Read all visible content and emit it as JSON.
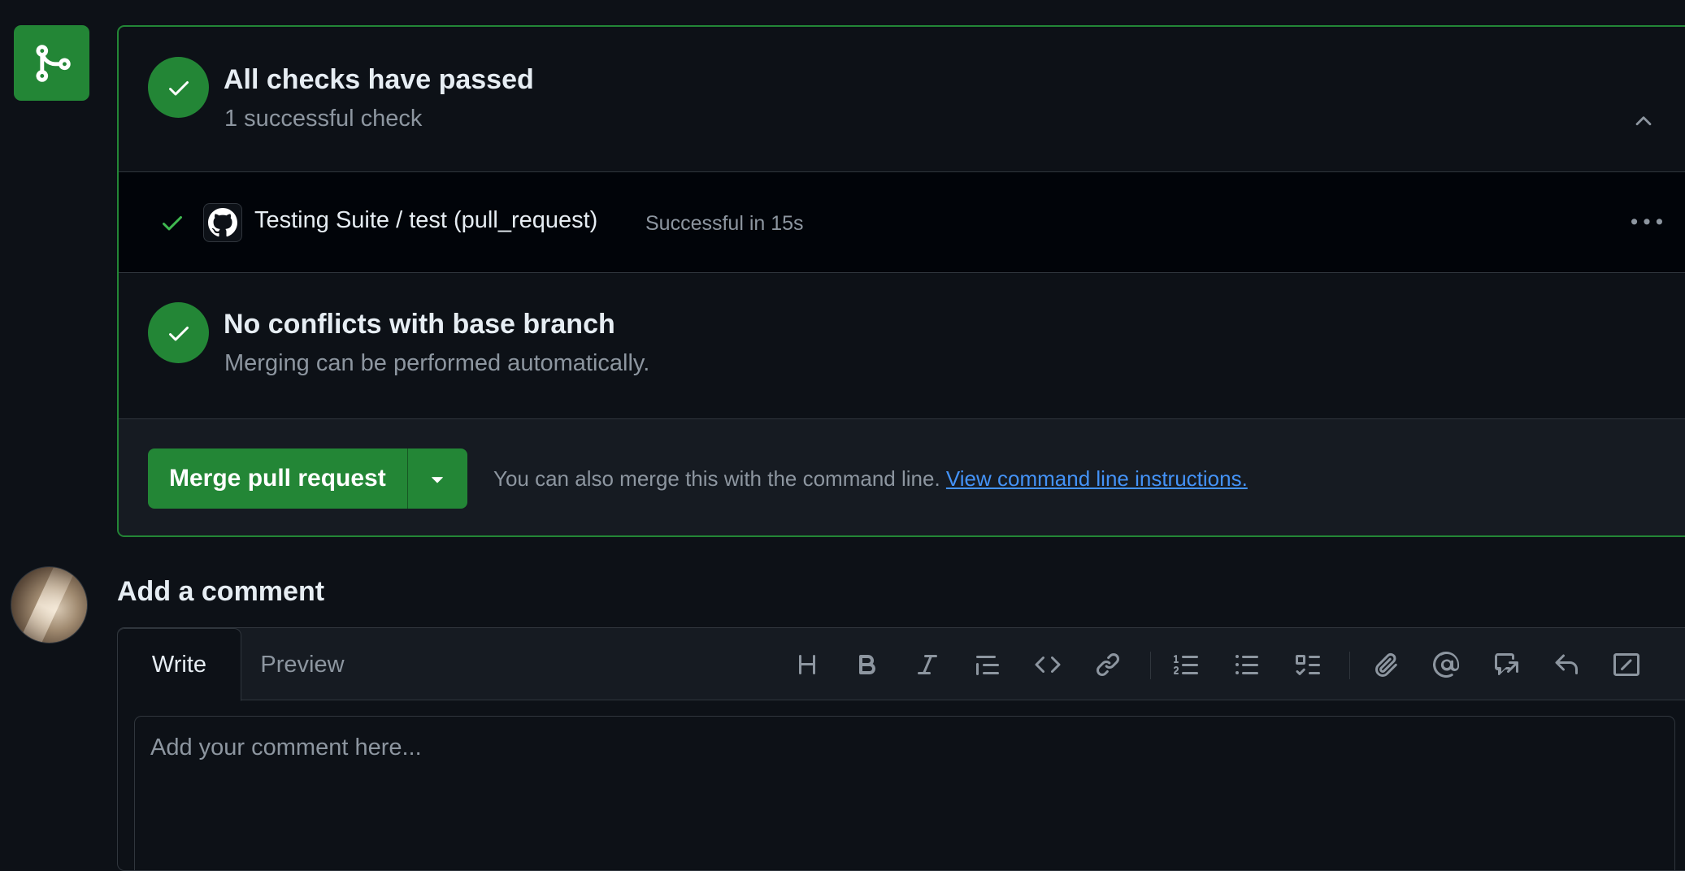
{
  "colors": {
    "background": "#0d1117",
    "success_green": "#238636",
    "link_blue": "#4493f8",
    "muted_text": "#8d96a0"
  },
  "merge_icon": "git-merge-icon",
  "checks": {
    "title": "All checks have passed",
    "subtitle": "1 successful check",
    "collapse_icon": "chevron-up-icon",
    "items": [
      {
        "name": "Testing Suite / test (pull_request)",
        "status": "Successful in 15s",
        "icon": "github-icon",
        "menu_icon": "kebab-horizontal-icon"
      }
    ]
  },
  "conflicts": {
    "title": "No conflicts with base branch",
    "subtitle": "Merging can be performed automatically."
  },
  "merge": {
    "button_label": "Merge pull request",
    "caret_icon": "triangle-down-icon",
    "hint_text": "You can also merge this with the command line.",
    "hint_link": "View command line instructions."
  },
  "comment": {
    "title": "Add a comment",
    "tabs": {
      "write": "Write",
      "preview": "Preview"
    },
    "toolbar_icons": [
      "heading-icon",
      "bold-icon",
      "italic-icon",
      "quote-icon",
      "code-icon",
      "link-icon",
      "ordered-list-icon",
      "unordered-list-icon",
      "task-list-icon",
      "attach-icon",
      "mention-icon",
      "cross-reference-icon",
      "reply-icon",
      "slash-command-icon"
    ],
    "placeholder": "Add your comment here..."
  }
}
